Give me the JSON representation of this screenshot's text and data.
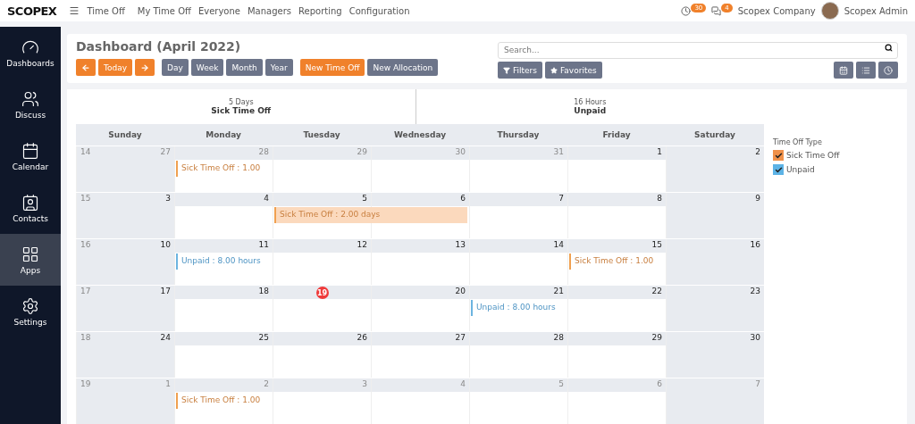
{
  "topbar": {
    "logo": "SCOPEX",
    "app": "Time Off",
    "menu": [
      "My Time Off",
      "Everyone",
      "Managers",
      "Reporting",
      "Configuration"
    ],
    "activity_count": "30",
    "message_count": "4",
    "company": "Scopex Company",
    "user": "Scopex Admin"
  },
  "sidebar": {
    "items": [
      {
        "label": "Dashboards",
        "kind": "dashboards",
        "selected": false
      },
      {
        "label": "Discuss",
        "kind": "discuss",
        "selected": false
      },
      {
        "label": "Calendar",
        "kind": "calendar",
        "selected": false
      },
      {
        "label": "Contacts",
        "kind": "contacts",
        "selected": false
      },
      {
        "label": "Apps",
        "kind": "apps",
        "selected": true
      },
      {
        "label": "Settings",
        "kind": "settings",
        "selected": false
      }
    ]
  },
  "control_panel": {
    "title": "Dashboard (April 2022)",
    "today": "Today",
    "scales": [
      "Day",
      "Week",
      "Month",
      "Year"
    ],
    "actions": [
      {
        "label": "New Time Off",
        "primary": true
      },
      {
        "label": "New Allocation",
        "primary": false
      }
    ],
    "search": {
      "placeholder": "Search..."
    },
    "filters": "Filters",
    "favorites": "Favorites"
  },
  "summary": [
    {
      "amount": "5",
      "unit": "Days",
      "name": "Sick Time Off"
    },
    {
      "amount": "16",
      "unit": "Hours",
      "name": "Unpaid"
    }
  ],
  "calendar": {
    "weekdays": [
      "Sunday",
      "Monday",
      "Tuesday",
      "Wednesday",
      "Thursday",
      "Friday",
      "Saturday"
    ],
    "weeks": [
      {
        "week": "14",
        "days": [
          {
            "date": "27",
            "other_month": true
          },
          {
            "date": "28",
            "other_month": true,
            "event": {
              "label": "Sick Time Off : 1.00",
              "kind": "sick",
              "all_day": false
            }
          },
          {
            "date": "29",
            "other_month": true
          },
          {
            "date": "30",
            "other_month": true
          },
          {
            "date": "31",
            "other_month": true
          },
          {
            "date": "1",
            "other_month": false
          },
          {
            "date": "2",
            "other_month": false
          }
        ]
      },
      {
        "week": "15",
        "days": [
          {
            "date": "3",
            "other_month": false
          },
          {
            "date": "4",
            "other_month": false
          },
          {
            "date": "5",
            "other_month": false,
            "event": {
              "label": "Sick Time Off : 2.00 days",
              "kind": "sick",
              "all_day": true
            }
          },
          {
            "date": "6",
            "other_month": false,
            "continued": true
          },
          {
            "date": "7",
            "other_month": false
          },
          {
            "date": "8",
            "other_month": false
          },
          {
            "date": "9",
            "other_month": false
          }
        ]
      },
      {
        "week": "16",
        "days": [
          {
            "date": "10",
            "other_month": false
          },
          {
            "date": "11",
            "other_month": false,
            "event": {
              "label": "Unpaid : 8.00 hours",
              "kind": "unpaid",
              "all_day": false
            }
          },
          {
            "date": "12",
            "other_month": false
          },
          {
            "date": "13",
            "other_month": false
          },
          {
            "date": "14",
            "other_month": false
          },
          {
            "date": "15",
            "other_month": false,
            "event": {
              "label": "Sick Time Off : 1.00",
              "kind": "sick",
              "all_day": false
            }
          },
          {
            "date": "16",
            "other_month": false
          }
        ]
      },
      {
        "week": "17",
        "days": [
          {
            "date": "17",
            "other_month": false
          },
          {
            "date": "18",
            "other_month": false
          },
          {
            "date": "19",
            "other_month": false,
            "today": true
          },
          {
            "date": "20",
            "other_month": false
          },
          {
            "date": "21",
            "other_month": false,
            "event": {
              "label": "Unpaid : 8.00 hours",
              "kind": "unpaid",
              "all_day": false
            }
          },
          {
            "date": "22",
            "other_month": false
          },
          {
            "date": "23",
            "other_month": false
          }
        ]
      },
      {
        "week": "18",
        "days": [
          {
            "date": "24",
            "other_month": false
          },
          {
            "date": "25",
            "other_month": false
          },
          {
            "date": "26",
            "other_month": false
          },
          {
            "date": "27",
            "other_month": false
          },
          {
            "date": "28",
            "other_month": false
          },
          {
            "date": "29",
            "other_month": false
          },
          {
            "date": "30",
            "other_month": false
          }
        ]
      },
      {
        "week": "19",
        "days": [
          {
            "date": "1",
            "other_month": true
          },
          {
            "date": "2",
            "other_month": true,
            "event": {
              "label": "Sick Time Off : 1.00",
              "kind": "sick",
              "all_day": false
            }
          },
          {
            "date": "3",
            "other_month": true
          },
          {
            "date": "4",
            "other_month": true
          },
          {
            "date": "5",
            "other_month": true
          },
          {
            "date": "6",
            "other_month": true
          },
          {
            "date": "7",
            "other_month": true
          }
        ]
      }
    ]
  },
  "legend": {
    "title": "Time Off Type",
    "items": [
      {
        "label": "Sick Time Off",
        "checked": true,
        "color": "#f0914a"
      },
      {
        "label": "Unpaid",
        "checked": true,
        "color": "#5db3e6"
      }
    ]
  }
}
